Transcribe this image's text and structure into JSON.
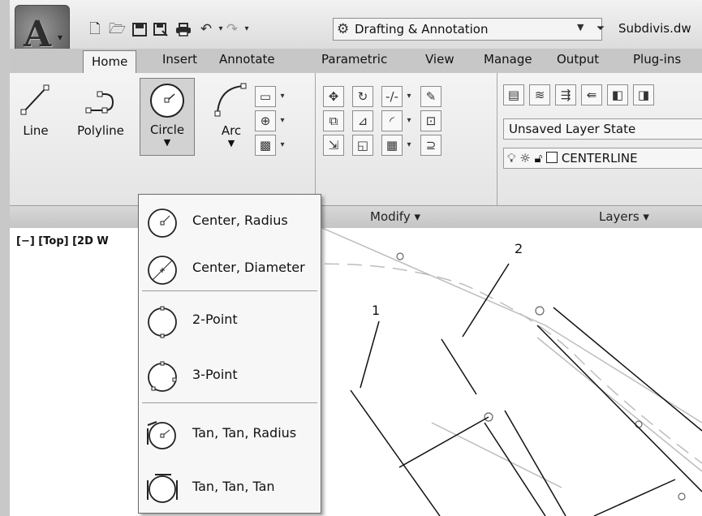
{
  "app": {
    "menu_letter": "A",
    "workspace": "Drafting & Annotation",
    "file_title": "Subdivis.dw",
    "quick_access_icons": [
      "new-icon",
      "open-icon",
      "save-icon",
      "save-as-icon",
      "plot-icon",
      "undo-icon",
      "redo-icon"
    ]
  },
  "tabs": [
    "Home",
    "Insert",
    "Annotate",
    "Parametric",
    "View",
    "Manage",
    "Output",
    "Plug-ins"
  ],
  "ribbon": {
    "draw_tools": {
      "line": "Line",
      "polyline": "Polyline",
      "circle": "Circle",
      "arc": "Arc"
    },
    "panels": {
      "modify": "Modify",
      "layers": "Layers"
    },
    "layer_state": "Unsaved Layer State",
    "current_layer": "CENTERLINE",
    "dropdown_marker": "▾"
  },
  "circle_menu": {
    "items": [
      {
        "label": "Center, Radius",
        "icon": "circle-center-radius-icon"
      },
      {
        "label": "Center, Diameter",
        "icon": "circle-center-diameter-icon"
      },
      {
        "label": "2-Point",
        "icon": "circle-2-point-icon"
      },
      {
        "label": "3-Point",
        "icon": "circle-3-point-icon"
      },
      {
        "label": "Tan, Tan, Radius",
        "icon": "circle-tan-tan-radius-icon"
      },
      {
        "label": "Tan, Tan, Tan",
        "icon": "circle-tan-tan-tan-icon"
      }
    ]
  },
  "drawing": {
    "viewport_label": "[−] [Top] [2D W",
    "callouts": [
      "1",
      "2"
    ]
  }
}
